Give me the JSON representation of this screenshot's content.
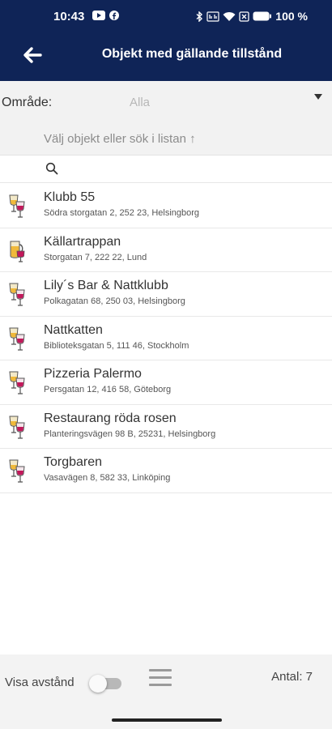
{
  "status_bar": {
    "time": "10:43",
    "battery": "100 %",
    "left_icons": [
      "youtube-icon",
      "facebook-icon"
    ],
    "right_icons": [
      "bluetooth-icon",
      "data-icon",
      "wifi-icon",
      "close-box-icon",
      "battery-icon"
    ]
  },
  "header": {
    "title": "Objekt med gällande tillstånd",
    "back_icon": "arrow-left-icon",
    "background": "#0f2457"
  },
  "filter": {
    "area_label": "Område:",
    "area_value": "Alla",
    "hint": "Välj objekt eller sök i listan ↑"
  },
  "search": {
    "placeholder": "",
    "value": ""
  },
  "items": [
    {
      "name": "Klubb 55",
      "address": "Södra storgatan 2, 252 23, Helsingborg",
      "icon": "wine-glasses-icon"
    },
    {
      "name": "Källartrappan",
      "address": "Storgatan 7, 222 22, Lund",
      "icon": "beer-glass-icon"
    },
    {
      "name": "Lily´s Bar & Nattklubb",
      "address": "Polkagatan 68, 250 03, Helsingborg",
      "icon": "wine-glasses-icon"
    },
    {
      "name": "Nattkatten",
      "address": "Biblioteksgatan 5, 111 46, Stockholm",
      "icon": "wine-glasses-icon"
    },
    {
      "name": "Pizzeria Palermo",
      "address": "Persgatan 12, 416 58, Göteborg",
      "icon": "wine-glasses-icon"
    },
    {
      "name": "Restaurang röda rosen",
      "address": "Planteringsvägen 98 B, 25231, Helsingborg",
      "icon": "wine-glasses-icon"
    },
    {
      "name": "Torgbaren",
      "address": "Vasavägen 8, 582 33, Linköping",
      "icon": "wine-glasses-icon"
    }
  ],
  "footer": {
    "distance_label": "Visa avstånd",
    "distance_toggle_on": false,
    "count_label": "Antal: 7"
  }
}
